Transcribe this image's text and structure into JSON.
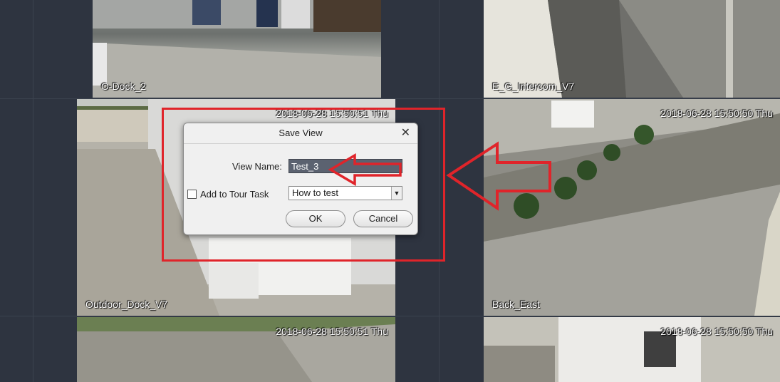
{
  "tiles": {
    "top_left": {
      "label": "O-Dock_2"
    },
    "top_right": {
      "label": "E_G_Intercom_V7"
    },
    "mid_left": {
      "label": "Outdoor_Dock_V7",
      "timestamp": "2018-06-28 15:50:51 Thu"
    },
    "mid_right": {
      "label": "Back_East",
      "timestamp": "2018-06-28 15:50:50 Thu"
    },
    "bot_left": {
      "timestamp": "2018-06-28 15:50:51 Thu"
    },
    "bot_right": {
      "timestamp": "2018-06-28 15:50:50 Thu"
    }
  },
  "dialog": {
    "title": "Save View",
    "close": "✕",
    "view_name_label": "View Name:",
    "view_name_value": "Test_3",
    "tour_label": "Add to Tour Task",
    "tour_checked": false,
    "tour_select_value": "How to test",
    "ok_label": "OK",
    "cancel_label": "Cancel"
  },
  "colors": {
    "annotation": "#e0242a",
    "background": "#2e3440"
  }
}
